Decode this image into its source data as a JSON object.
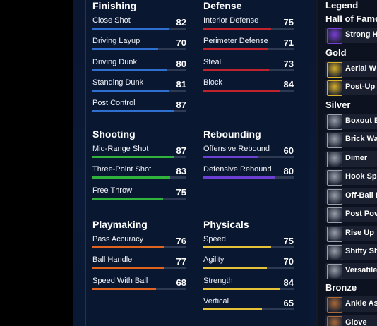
{
  "sections": [
    {
      "key": "finishing",
      "title": "Finishing",
      "color": "#2f6fd0",
      "stats": [
        {
          "name": "Close Shot",
          "value": 82
        },
        {
          "name": "Driving Layup",
          "value": 70
        },
        {
          "name": "Driving Dunk",
          "value": 80
        },
        {
          "name": "Standing Dunk",
          "value": 81
        },
        {
          "name": "Post Control",
          "value": 87
        }
      ]
    },
    {
      "key": "defense",
      "title": "Defense",
      "color": "#c0222e",
      "stats": [
        {
          "name": "Interior Defense",
          "value": 75
        },
        {
          "name": "Perimeter Defense",
          "value": 71
        },
        {
          "name": "Steal",
          "value": 73
        },
        {
          "name": "Block",
          "value": 84
        }
      ]
    },
    {
      "key": "shooting",
      "title": "Shooting",
      "color": "#2fb33c",
      "stats": [
        {
          "name": "Mid-Range Shot",
          "value": 87
        },
        {
          "name": "Three-Point Shot",
          "value": 83
        },
        {
          "name": "Free Throw",
          "value": 75
        }
      ]
    },
    {
      "key": "rebounding",
      "title": "Rebounding",
      "color": "#6b3fd1",
      "stats": [
        {
          "name": "Offensive Rebound",
          "value": 60
        },
        {
          "name": "Defensive Rebound",
          "value": 80
        }
      ]
    },
    {
      "key": "playmaking",
      "title": "Playmaking",
      "color": "#e0641e",
      "stats": [
        {
          "name": "Pass Accuracy",
          "value": 76
        },
        {
          "name": "Ball Handle",
          "value": 77
        },
        {
          "name": "Speed With Ball",
          "value": 68
        }
      ]
    },
    {
      "key": "physicals",
      "title": "Physicals",
      "color": "#e6c23a",
      "stats": [
        {
          "name": "Speed",
          "value": 75
        },
        {
          "name": "Agility",
          "value": 70
        },
        {
          "name": "Strength",
          "value": 84
        },
        {
          "name": "Vertical",
          "value": 65
        }
      ]
    }
  ],
  "legend": {
    "title": "Legend",
    "groups": [
      {
        "name": "Hall of Fame",
        "tier": "hof",
        "color": "#7b3fd6",
        "badges": [
          "Strong H"
        ]
      },
      {
        "name": "Gold",
        "tier": "gold",
        "color": "#d9b02a",
        "badges": [
          "Aerial W",
          "Post-Up"
        ]
      },
      {
        "name": "Silver",
        "tier": "silver",
        "color": "#9aa0aa",
        "badges": [
          "Boxout B",
          "Brick Wa",
          "Dimer",
          "Hook Sp",
          "Off-Ball I",
          "Post Pov",
          "Rise Up",
          "Shifty Sh",
          "Versatile"
        ]
      },
      {
        "name": "Bronze",
        "tier": "bronze",
        "color": "#a86a3a",
        "badges": [
          "Ankle As",
          "Glove"
        ]
      }
    ]
  }
}
